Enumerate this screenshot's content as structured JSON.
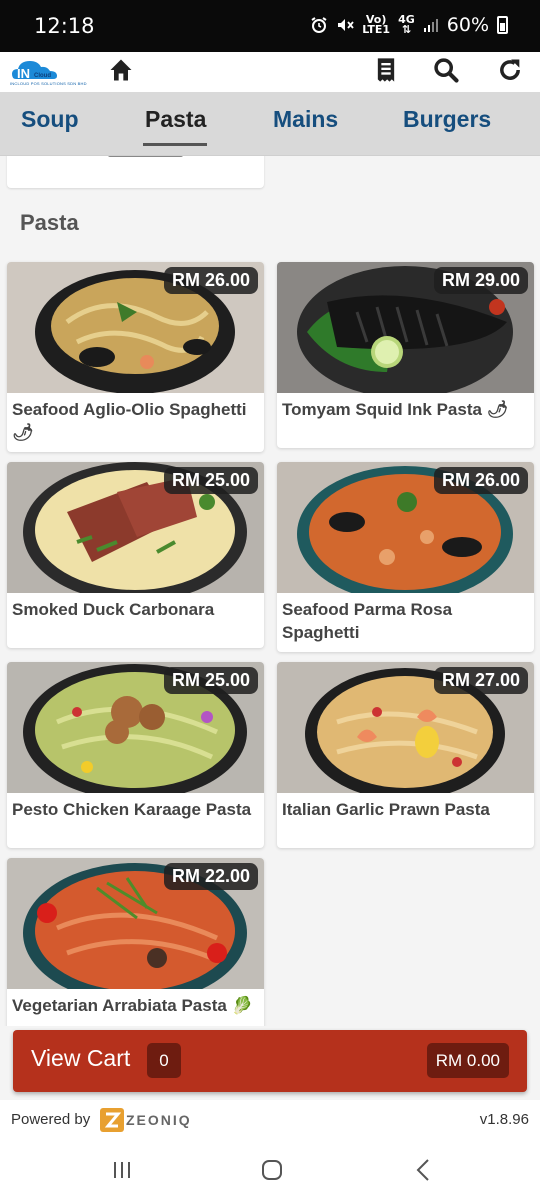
{
  "status_bar": {
    "time": "12:18",
    "network_top": "Vo)",
    "network_bottom": "LTE1",
    "network_type": "4G",
    "battery": "60%"
  },
  "app_bar": {
    "logo_text": "IN",
    "logo_cloud_text": "Cloud",
    "logo_subtitle": "INCLOUD POS SOLUTIONS SDN BHD"
  },
  "tabs": [
    {
      "label": "Soup",
      "active": false
    },
    {
      "label": "Pasta",
      "active": true
    },
    {
      "label": "Mains",
      "active": false
    },
    {
      "label": "Burgers",
      "active": false
    }
  ],
  "section": {
    "title": "Pasta"
  },
  "items": [
    {
      "name": "Seafood Aglio-Olio Spaghetti 🌶",
      "price": "RM 26.00"
    },
    {
      "name": "Tomyam Squid Ink Pasta 🌶",
      "price": "RM 29.00"
    },
    {
      "name": "Smoked Duck Carbonara",
      "price": "RM 25.00"
    },
    {
      "name": "Seafood Parma Rosa Spaghetti",
      "price": "RM 26.00"
    },
    {
      "name": "Pesto Chicken Karaage Pasta",
      "price": "RM 25.00"
    },
    {
      "name": "Italian Garlic Prawn Pasta",
      "price": "RM 27.00"
    },
    {
      "name": "Vegetarian Arrabiata Pasta 🥬",
      "price": "RM 22.00"
    }
  ],
  "cart": {
    "label": "View Cart",
    "count": "0",
    "total": "RM 0.00"
  },
  "footer": {
    "powered_by": "Powered by",
    "brand": "ZEONIQ",
    "version": "v1.8.96"
  },
  "colors": {
    "accent": "#b5311c",
    "tab_text": "#164e7e",
    "logo_blue": "#0b5ea8"
  },
  "icons": [
    "home-icon",
    "receipt-icon",
    "search-icon",
    "refresh-icon",
    "recents-icon",
    "home-nav-icon",
    "back-icon"
  ]
}
